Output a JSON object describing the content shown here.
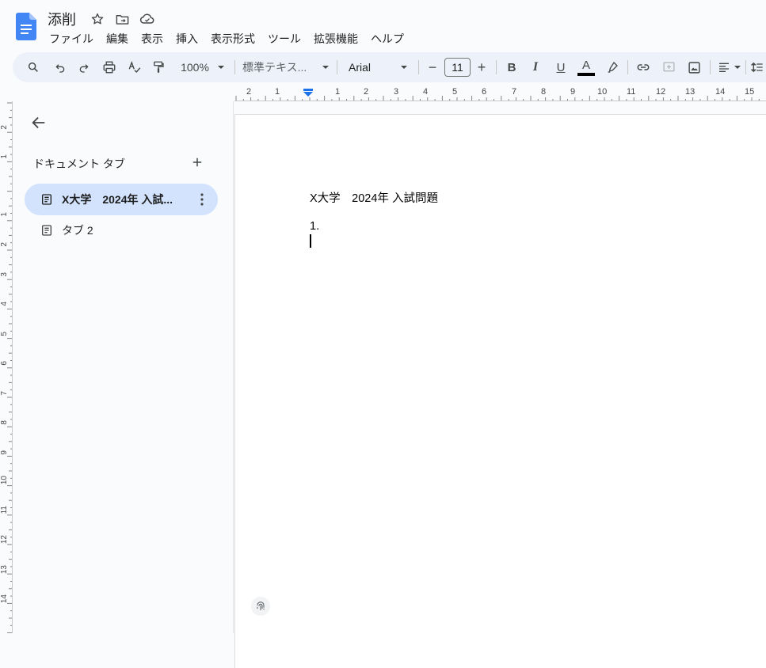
{
  "app": {
    "doc_title": "添削",
    "icons": [
      "docs-logo-icon",
      "star-icon",
      "move-to-folder-icon",
      "cloud-saved-icon"
    ]
  },
  "menu": {
    "items": [
      "ファイル",
      "編集",
      "表示",
      "挿入",
      "表示形式",
      "ツール",
      "拡張機能",
      "ヘルプ"
    ]
  },
  "toolbar": {
    "zoom": "100%",
    "style": "標準テキス...",
    "font": "Arial",
    "font_size": "11",
    "minus": "−",
    "plus": "+",
    "bold": "B",
    "italic": "I",
    "underline": "U",
    "text_color": "A",
    "text_color_value": "#000000"
  },
  "ruler": {
    "h_labels": [
      "2",
      "1",
      "1",
      "2",
      "3",
      "4",
      "5",
      "6",
      "7",
      "8",
      "9",
      "10",
      "11",
      "12",
      "13",
      "14",
      "15"
    ],
    "v_labels": [
      "2",
      "1",
      "1",
      "2",
      "3",
      "4",
      "5",
      "6",
      "7",
      "8",
      "9",
      "10",
      "11",
      "12",
      "13",
      "14"
    ]
  },
  "sidebar": {
    "header": "ドキュメント タブ",
    "tabs": [
      {
        "label": "X大学　2024年 入試...",
        "active": true
      },
      {
        "label": "タブ 2",
        "active": false
      }
    ]
  },
  "document": {
    "heading": "X大学　2024年 入試問題",
    "list_item_number": "1."
  },
  "colors": {
    "accent": "#1a73e8",
    "active_tab_bg": "#d3e3fd",
    "toolbar_bg": "#edf2fa"
  }
}
